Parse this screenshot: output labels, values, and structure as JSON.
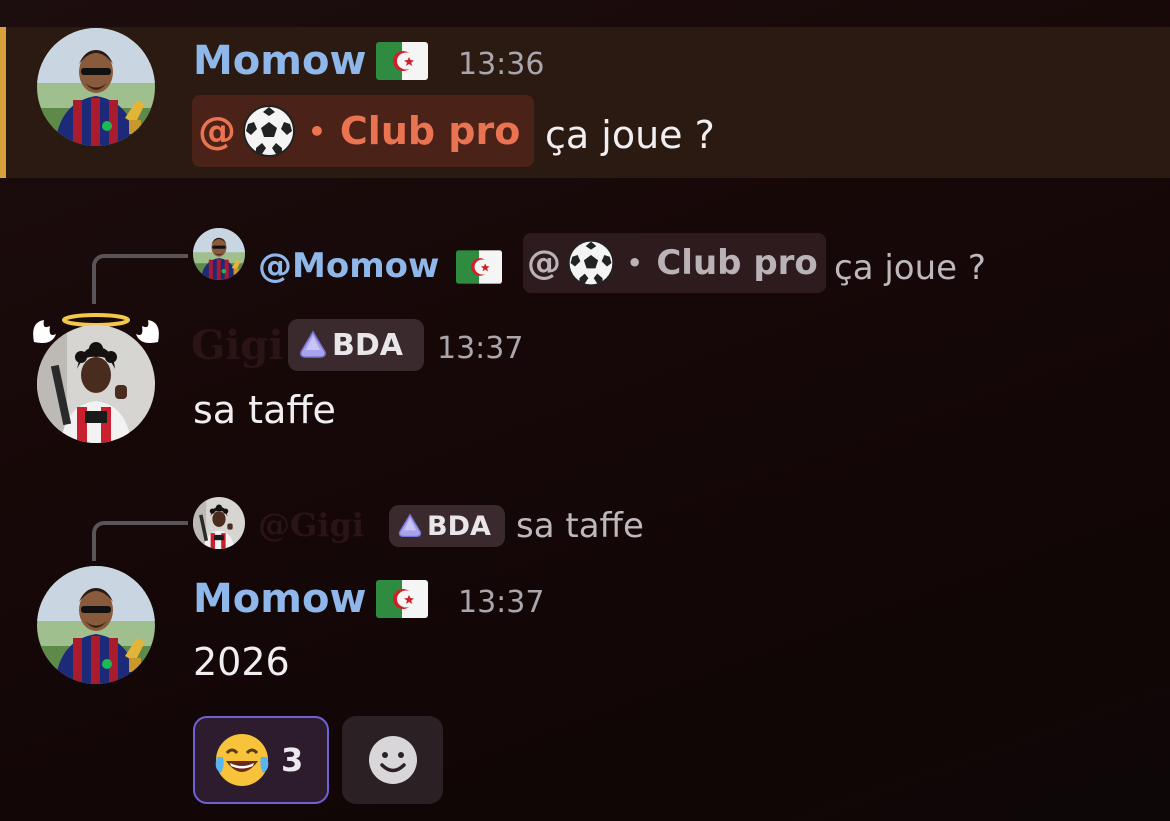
{
  "colors": {
    "highlight_bar": "#d9a13b",
    "username": "#8fb7ea",
    "mention": "#ea7452",
    "reaction_border": "#6e63d6"
  },
  "messages": [
    {
      "author": "Momow",
      "flag": "algeria-flag-icon",
      "time": "13:36",
      "mention_prefix": "@",
      "mention_emoji": "soccer-ball-icon",
      "mention_sep": "•",
      "mention_role": "Club pro",
      "text": "ça joue ?",
      "highlighted": true
    },
    {
      "reply": {
        "author": "@Momow",
        "flag": "algeria-flag-icon",
        "mention_prefix": "@",
        "mention_emoji": "soccer-ball-icon",
        "mention_sep": "•",
        "mention_role": "Club pro",
        "text": "ça joue ?"
      },
      "author": "Gigi",
      "badge": "BDA",
      "time": "13:37",
      "text": "sa taffe"
    },
    {
      "reply": {
        "author": "@Gigi",
        "badge": "BDA",
        "text": "sa taffe"
      },
      "author": "Momow",
      "flag": "algeria-flag-icon",
      "time": "13:37",
      "text": "2026",
      "reactions": [
        {
          "emoji": "joy-emoji-icon",
          "count": "3",
          "selected": true
        }
      ],
      "add_reaction_icon": "smiley-add-reaction-icon"
    }
  ]
}
